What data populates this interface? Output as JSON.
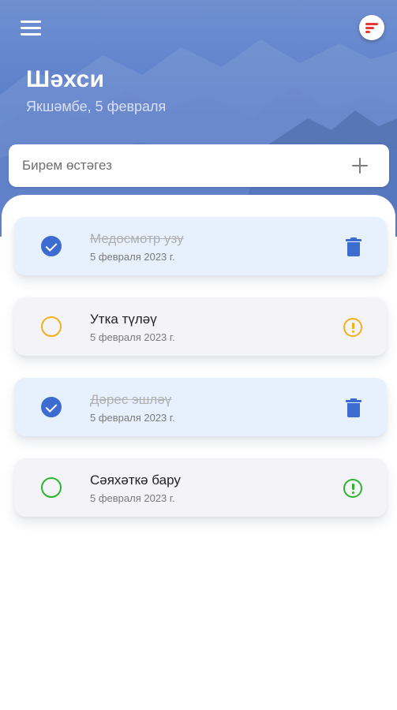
{
  "header": {
    "title": "Шәхси",
    "date": "Якшәмбе, 5 февраля",
    "menu_icon": "hamburger-menu-icon",
    "filter_icon": "sort-filter-icon"
  },
  "add_task": {
    "placeholder": "Бирем өстәгез",
    "add_icon": "plus-icon"
  },
  "colors": {
    "accent_blue": "#3d6cd0",
    "warning_yellow": "#f2b11c",
    "success_green": "#2bb52b",
    "filter_red": "#e53935"
  },
  "tasks": [
    {
      "name": "Медосмотр узу",
      "date": "5 февраля 2023 г.",
      "completed": true,
      "icon": "trash-icon"
    },
    {
      "name": "Утка түләү",
      "date": "5 февраля 2023 г.",
      "completed": false,
      "icon": "alert-circle-icon",
      "color": "#f2b11c"
    },
    {
      "name": "Дәрес эшләү",
      "date": "5 февраля 2023 г.",
      "completed": true,
      "icon": "trash-icon"
    },
    {
      "name": "Сәяхәткә бару",
      "date": "5 февраля 2023 г.",
      "completed": false,
      "icon": "alert-circle-icon",
      "color": "#2bb52b"
    }
  ]
}
